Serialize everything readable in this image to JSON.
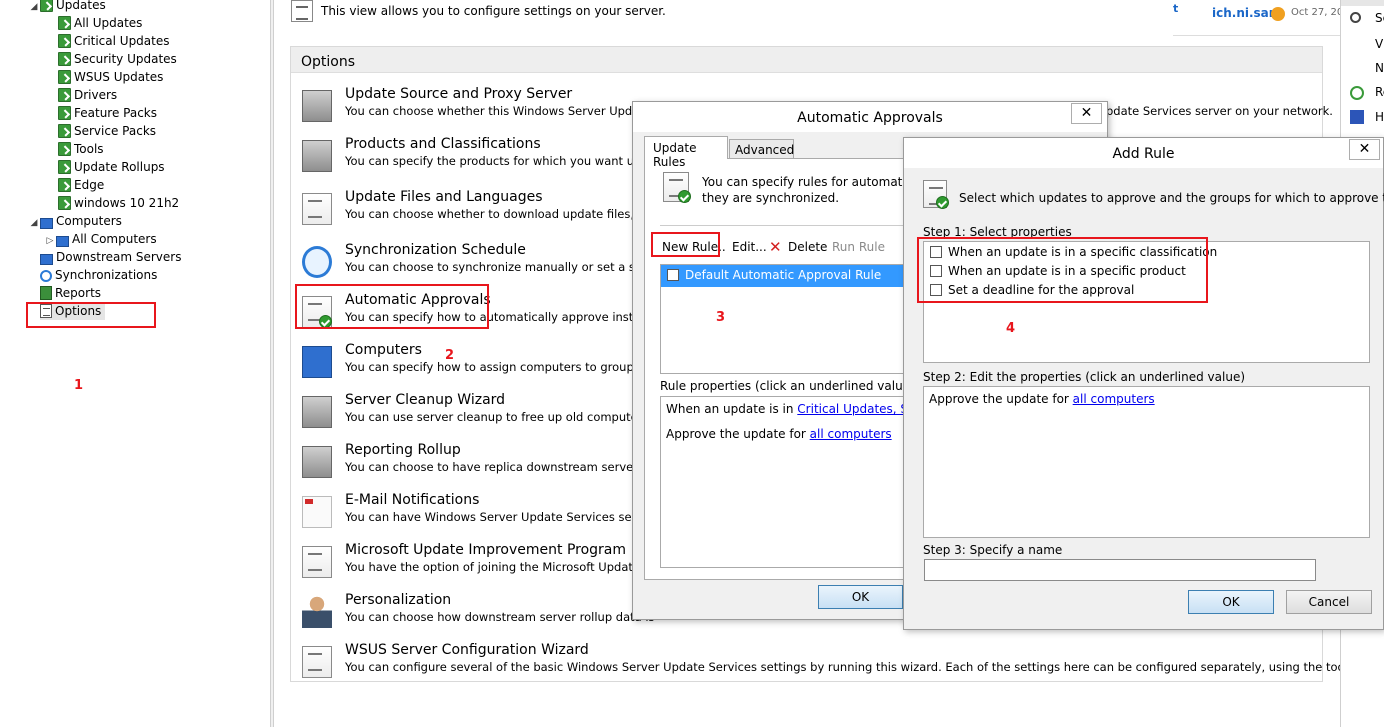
{
  "tree": {
    "updates": "Updates",
    "all_updates": "All Updates",
    "critical_updates": "Critical Updates",
    "security_updates": "Security Updates",
    "wsus_updates": "WSUS Updates",
    "drivers": "Drivers",
    "feature_packs": "Feature Packs",
    "service_packs": "Service Packs",
    "tools": "Tools",
    "update_rollups": "Update Rollups",
    "edge": "Edge",
    "windows10": "windows 10 21h2",
    "computers": "Computers",
    "all_computers": "All Computers",
    "downstream_servers": "Downstream Servers",
    "synchronizations": "Synchronizations",
    "reports": "Reports",
    "options": "Options"
  },
  "header": {
    "text": "This view allows you to configure settings on your server."
  },
  "options_panel": {
    "title": "Options",
    "items": [
      {
        "title": "Update Source and Proxy Server",
        "desc": "You can choose whether this Windows Server Update S"
      },
      {
        "title": "Products and Classifications",
        "desc": "You can specify the products for which you want upda"
      },
      {
        "title": "Update Files and Languages",
        "desc": "You can choose whether to download update files, whe"
      },
      {
        "title": "Synchronization Schedule",
        "desc": "You can choose to synchronize manually or set a sched"
      },
      {
        "title": "Automatic Approvals",
        "desc": "You can specify how to automatically approve installa"
      },
      {
        "title": "Computers",
        "desc": "You can specify how to assign computers to groups."
      },
      {
        "title": "Server Cleanup Wizard",
        "desc": "You can use server cleanup to free up old computers, u"
      },
      {
        "title": "Reporting Rollup",
        "desc": "You can choose to have replica downstream servers rol"
      },
      {
        "title": "E-Mail Notifications",
        "desc": "You can have Windows Server Update Services send e-"
      },
      {
        "title": "Microsoft Update Improvement Program",
        "desc": "You have the option of joining the Microsoft Update In"
      },
      {
        "title": "Personalization",
        "desc": "You can choose how downstream server rollup data is"
      },
      {
        "title": "WSUS Server Configuration Wizard",
        "desc": "You can configure several of the basic Windows Server Update Services settings by running this wizard. Each of the settings here can be configured separately, using the tools above."
      }
    ],
    "update_source_tail": "pdate Services server on your network."
  },
  "annotations": {
    "n1": "1",
    "n2": "2",
    "n3": "3",
    "n4": "4"
  },
  "snippet": {
    "left_char": "t",
    "user": "ich.ni.san",
    "date": "Oct 27, 20"
  },
  "right_actions": {
    "a1": "Se",
    "a2": "Vi",
    "a3": "N",
    "a4": "Re",
    "a5": "H"
  },
  "auto_approvals": {
    "title": "Automatic Approvals",
    "close": "✕",
    "tab_rules": "Update Rules",
    "tab_advanced": "Advanced",
    "intro_line1": "You can specify rules for automatically",
    "intro_line2": "they are synchronized.",
    "new_rule": "New Rule..",
    "edit": "Edit...",
    "delete": "Delete",
    "run_rule": "Run Rule",
    "rule_item": "Default Automatic Approval Rule",
    "rule_props_label": "Rule properties (click an underlined value to ed",
    "props_line1_prefix": "When an update is in ",
    "props_line1_link": "Critical Updates, Securit",
    "props_line2_prefix": "Approve the update for ",
    "props_line2_link": "all computers",
    "ok": "OK"
  },
  "add_rule": {
    "title": "Add Rule",
    "close": "✕",
    "intro": "Select which updates to approve and the groups for which to approve them.",
    "step1": "Step 1: Select properties",
    "prop1": "When an update is in a specific classification",
    "prop2": "When an update is in a specific product",
    "prop3": "Set a deadline for the approval",
    "step2": "Step 2: Edit the properties (click an underlined value)",
    "edit_prefix": "Approve the update for ",
    "edit_link": "all computers",
    "step3": "Step 3: Specify a name",
    "name_value": "",
    "ok": "OK",
    "cancel": "Cancel"
  }
}
